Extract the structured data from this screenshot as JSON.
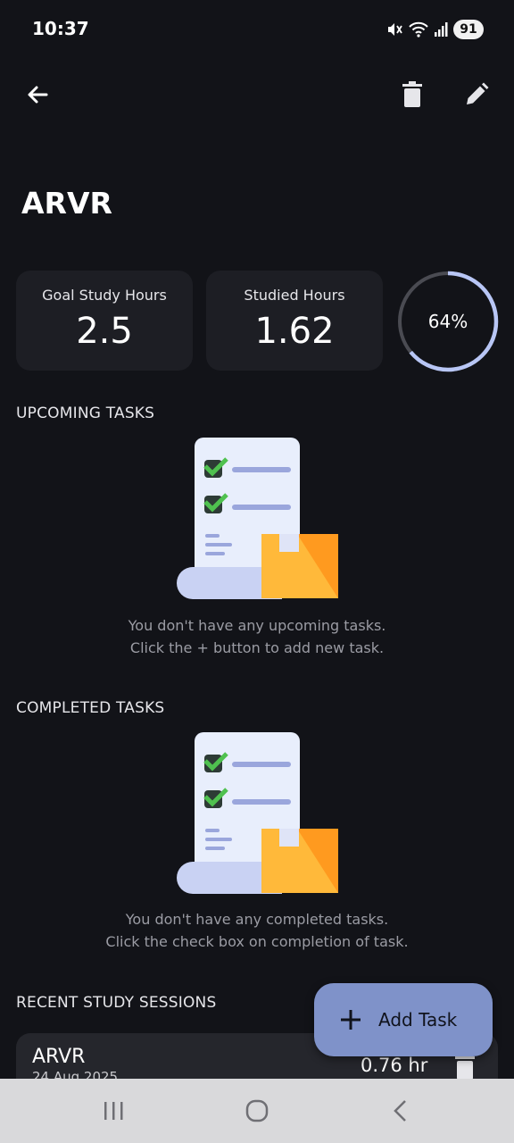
{
  "status_bar": {
    "time": "10:37",
    "battery": "91",
    "icons": [
      "mute-icon",
      "wifi-icon",
      "signal-icon",
      "battery-icon"
    ]
  },
  "app_bar": {
    "icons": [
      "back-arrow-icon",
      "trash-icon",
      "pencil-icon"
    ]
  },
  "subject": {
    "name": "ARVR"
  },
  "stats": {
    "goal_label": "Goal Study Hours",
    "goal_value": "2.5",
    "studied_label": "Studied Hours",
    "studied_value": "1.62",
    "progress_text": "64%",
    "progress_fraction": 0.64
  },
  "upcoming": {
    "title": "UPCOMING TASKS",
    "empty_line1": "You don't have any upcoming tasks.",
    "empty_line2": "Click the + button to add new task."
  },
  "completed": {
    "title": "COMPLETED TASKS",
    "empty_line1": "You don't have any completed tasks.",
    "empty_line2": "Click the check box on completion of task."
  },
  "sessions": {
    "title": "RECENT STUDY SESSIONS",
    "items": [
      {
        "name": "ARVR",
        "date": "24 Aug 2025",
        "duration": "0.76 hr"
      }
    ]
  },
  "fab": {
    "label": "Add Task",
    "icon": "plus-icon"
  },
  "nav": {
    "icons": [
      "recents-icon",
      "home-icon",
      "back-icon"
    ]
  },
  "colors": {
    "background": "#121318",
    "card": "#1d1e24",
    "accent": "#b8c6f5",
    "ring_track": "#4a4b52",
    "fab": "#7f92c9",
    "muted_text": "#9b9ca4"
  }
}
